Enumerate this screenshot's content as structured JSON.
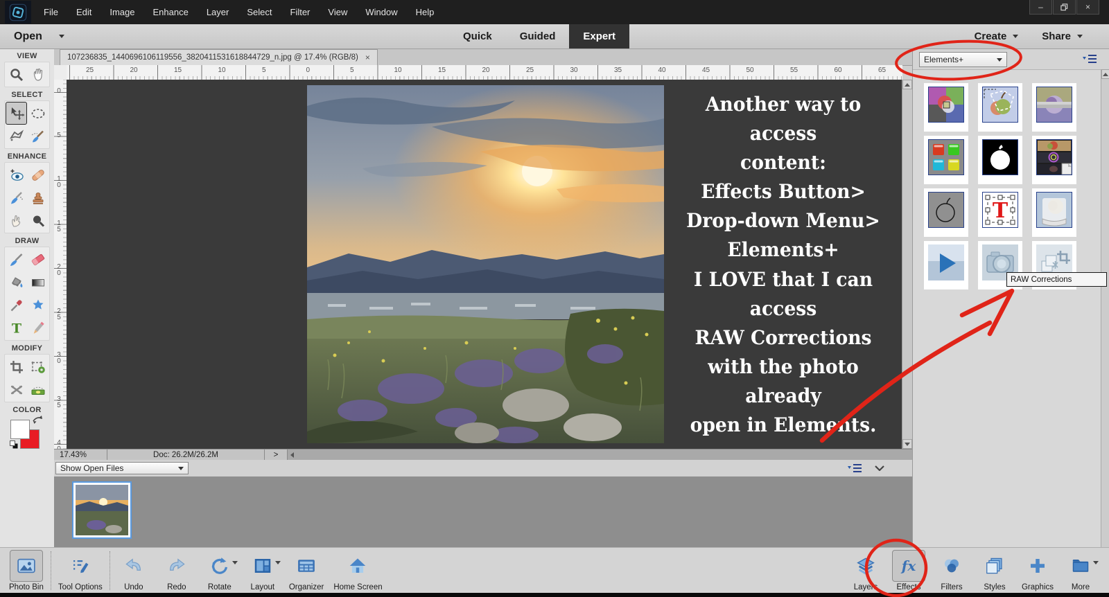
{
  "menu_bar": [
    "File",
    "Edit",
    "Image",
    "Enhance",
    "Layer",
    "Select",
    "Filter",
    "View",
    "Window",
    "Help"
  ],
  "window_controls": {
    "minimize": "–",
    "close": "×"
  },
  "action_bar": {
    "open_label": "Open",
    "mode_tabs": [
      {
        "label": "Quick",
        "active": false
      },
      {
        "label": "Guided",
        "active": false
      },
      {
        "label": "Expert",
        "active": true
      }
    ],
    "create_label": "Create",
    "share_label": "Share"
  },
  "document_tab": {
    "title": "107236835_1440696106119556_3820411531618844729_n.jpg @ 17.4% (RGB/8)",
    "close": "×"
  },
  "rulers": {
    "horizontal": [
      "25",
      "20",
      "15",
      "10",
      "5",
      "0",
      "5",
      "10",
      "15",
      "20",
      "25",
      "30",
      "35",
      "40",
      "45",
      "50",
      "55",
      "60",
      "65"
    ],
    "vertical": [
      "0",
      "5",
      "10",
      "15",
      "20",
      "25",
      "30",
      "35",
      "40"
    ]
  },
  "canvas_overlay": {
    "block1_lines": [
      "Another way to access",
      "content:",
      "Effects Button>",
      "Drop-down Menu>",
      "Elements+"
    ],
    "block2_lines": [
      "I LOVE that I can access",
      "RAW Corrections",
      "with the photo already",
      "open in Elements."
    ]
  },
  "tool_panel": {
    "sections": [
      {
        "label": "VIEW",
        "tools": [
          {
            "name": "zoom-tool",
            "icon": "zoom"
          },
          {
            "name": "hand-tool",
            "icon": "hand"
          }
        ]
      },
      {
        "label": "SELECT",
        "tools": [
          {
            "name": "move-tool",
            "icon": "move",
            "selected": true
          },
          {
            "name": "marquee-tool",
            "icon": "marquee"
          },
          {
            "name": "lasso-tool",
            "icon": "lasso"
          },
          {
            "name": "quick-selection-tool",
            "icon": "selbrush"
          }
        ]
      },
      {
        "label": "ENHANCE",
        "tools": [
          {
            "name": "red-eye-tool",
            "icon": "eye"
          },
          {
            "name": "spot-healing-tool",
            "icon": "healing"
          },
          {
            "name": "smart-brush-tool",
            "icon": "smartbrush"
          },
          {
            "name": "clone-stamp-tool",
            "icon": "stamp"
          },
          {
            "name": "smudge-tool",
            "icon": "smudge"
          },
          {
            "name": "blur-tool",
            "icon": "blur"
          }
        ]
      },
      {
        "label": "DRAW",
        "tools": [
          {
            "name": "brush-tool",
            "icon": "brush"
          },
          {
            "name": "eraser-tool",
            "icon": "eraser"
          },
          {
            "name": "paint-bucket-tool",
            "icon": "bucket"
          },
          {
            "name": "gradient-tool",
            "icon": "gradient"
          },
          {
            "name": "eyedropper-tool",
            "icon": "eyedropper"
          },
          {
            "name": "shape-tool",
            "icon": "shape"
          },
          {
            "name": "type-tool",
            "icon": "type"
          },
          {
            "name": "pencil-tool",
            "icon": "pencil"
          }
        ]
      },
      {
        "label": "MODIFY",
        "tools": [
          {
            "name": "crop-tool",
            "icon": "crop"
          },
          {
            "name": "recompose-tool",
            "icon": "recompose"
          },
          {
            "name": "content-aware-move-tool",
            "icon": "cmove"
          },
          {
            "name": "straighten-tool",
            "icon": "straighten"
          }
        ]
      }
    ],
    "color_label": "COLOR",
    "foreground_color": "#ffffff",
    "background_color": "#e81c24"
  },
  "status_bar": {
    "zoom_level": "17.43%",
    "doc_size": "Doc: 26.2M/26.2M",
    "expand_glyph": ">"
  },
  "photo_bin": {
    "dropdown_value": "Show Open Files"
  },
  "effects_panel": {
    "dropdown_value": "Elements+",
    "tooltip": "RAW Corrections",
    "thumbnails": [
      {
        "name": "effect-color-quadrants",
        "icon": "th_quadrants",
        "framed": true
      },
      {
        "name": "effect-apple-selection",
        "icon": "th_selection",
        "framed": true
      },
      {
        "name": "effect-apple-duotone",
        "icon": "th_duotone",
        "framed": true
      },
      {
        "name": "effect-color-swatches",
        "icon": "th_swatches",
        "framed": true
      },
      {
        "name": "effect-apple-mask",
        "icon": "th_mask",
        "framed": true
      },
      {
        "name": "effect-photo-strip",
        "icon": "th_strip",
        "framed": true
      },
      {
        "name": "effect-apple-sketch",
        "icon": "th_sketch",
        "framed": true
      },
      {
        "name": "effect-type-mask",
        "icon": "th_type",
        "framed": true
      },
      {
        "name": "effect-apple-scroll",
        "icon": "th_scroll",
        "framed": true
      },
      {
        "name": "content-video",
        "icon": "th_play",
        "framed": false
      },
      {
        "name": "content-raw-corrections",
        "icon": "th_camera",
        "framed": false
      },
      {
        "name": "content-crop-tools",
        "icon": "th_crop",
        "framed": false
      }
    ]
  },
  "taskbar": {
    "left": [
      {
        "label": "Photo Bin",
        "icon": "tb_photobin",
        "selected": true,
        "sep_after": true
      },
      {
        "label": "Tool Options",
        "icon": "tb_tooloptions",
        "sep_after": true
      },
      {
        "label": "Undo",
        "icon": "tb_undo"
      },
      {
        "label": "Redo",
        "icon": "tb_redo"
      },
      {
        "label": "Rotate",
        "icon": "tb_rotate",
        "caret": true
      },
      {
        "label": "Layout",
        "icon": "tb_layout",
        "caret": true
      },
      {
        "label": "Organizer",
        "icon": "tb_organizer"
      },
      {
        "label": "Home Screen",
        "icon": "tb_home"
      }
    ],
    "right": [
      {
        "label": "Layers",
        "icon": "tb_layers"
      },
      {
        "label": "Effects",
        "icon": "tb_effects",
        "selected": true
      },
      {
        "label": "Filters",
        "icon": "tb_filters"
      },
      {
        "label": "Styles",
        "icon": "tb_styles"
      },
      {
        "label": "Graphics",
        "icon": "tb_graphics"
      },
      {
        "label": "More",
        "icon": "tb_more",
        "caret": true
      }
    ]
  },
  "annotation_color": "#e02418"
}
